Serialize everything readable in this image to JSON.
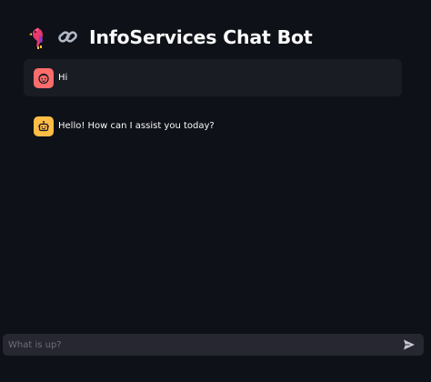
{
  "header": {
    "title": "InfoServices Chat Bot",
    "parrot_icon": "parrot-emoji",
    "link_icon": "link-emoji"
  },
  "messages": [
    {
      "role": "user",
      "avatar_icon": "user-face-icon",
      "avatar_color": "#ff6c6c",
      "text": "Hi"
    },
    {
      "role": "assistant",
      "avatar_icon": "robot-icon",
      "avatar_color": "#ffbd45",
      "text": "Hello! How can I assist you today?"
    }
  ],
  "chat_input": {
    "placeholder": "What is up?",
    "value": "",
    "send_icon": "send-icon"
  },
  "colors": {
    "background": "#0e1117",
    "user_message_bg": "#1a1c24",
    "input_bg": "#262730"
  }
}
